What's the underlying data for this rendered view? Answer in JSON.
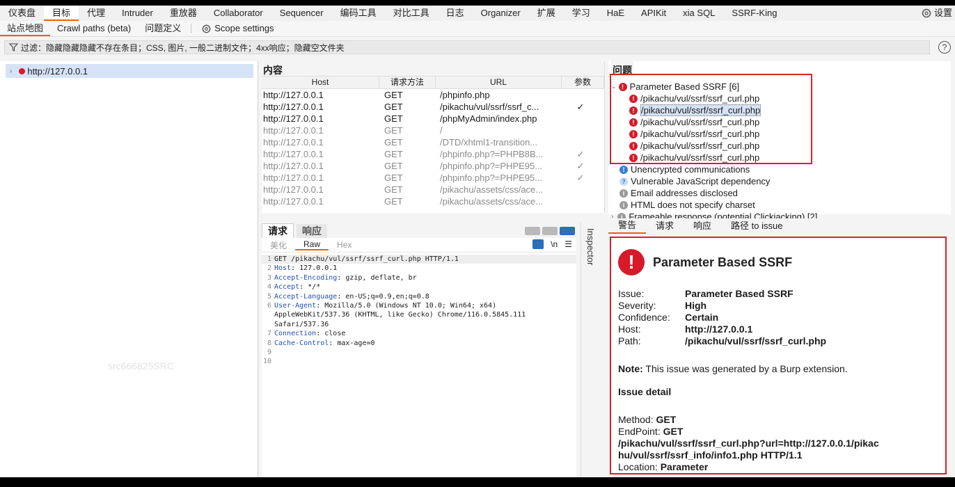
{
  "top_tabs": [
    "仪表盘",
    "目标",
    "代理",
    "Intruder",
    "重放器",
    "Collaborator",
    "Sequencer",
    "编码工具",
    "对比工具",
    "日志",
    "Organizer",
    "扩展",
    "学习",
    "HaE",
    "APIKit",
    "xia SQL",
    "SSRF-King"
  ],
  "settings_label": "设置",
  "sub_tabs": [
    "站点地图",
    "Crawl paths (beta)",
    "问题定义",
    "Scope settings"
  ],
  "filter_text": "过滤：隐藏隐藏隐藏不存在条目；CSS, 图片, 一般二进制文件；4xx响应；隐藏空文件夹",
  "sitemap": {
    "host": "http://127.0.0.1",
    "watermark": "src666825SRC"
  },
  "content": {
    "title": "内容",
    "columns": [
      "Host",
      "请求方法",
      "URL",
      "参数"
    ],
    "rows": [
      {
        "host": "http://127.0.0.1",
        "method": "GET",
        "url": "/phpinfo.php",
        "param": ""
      },
      {
        "host": "http://127.0.0.1",
        "method": "GET",
        "url": "/pikachu/vul/ssrf/ssrf_c...",
        "param": "✓"
      },
      {
        "host": "http://127.0.0.1",
        "method": "GET",
        "url": "/phpMyAdmin/index.php",
        "param": ""
      },
      {
        "host": "http://127.0.0.1",
        "method": "GET",
        "url": "/",
        "param": ""
      },
      {
        "host": "http://127.0.0.1",
        "method": "GET",
        "url": "/DTD/xhtml1-transition...",
        "param": ""
      },
      {
        "host": "http://127.0.0.1",
        "method": "GET",
        "url": "/phpinfo.php?=PHPB8B...",
        "param": "✓"
      },
      {
        "host": "http://127.0.0.1",
        "method": "GET",
        "url": "/phpinfo.php?=PHPE95...",
        "param": "✓"
      },
      {
        "host": "http://127.0.0.1",
        "method": "GET",
        "url": "/phpinfo.php?=PHPE95...",
        "param": "✓"
      },
      {
        "host": "http://127.0.0.1",
        "method": "GET",
        "url": "/pikachu/assets/css/ace...",
        "param": ""
      },
      {
        "host": "http://127.0.0.1",
        "method": "GET",
        "url": "/pikachu/assets/css/ace...",
        "param": ""
      }
    ]
  },
  "request": {
    "tab_request": "请求",
    "tab_response": "响应",
    "view_tabs": [
      "美化",
      "Raw",
      "Hex"
    ],
    "newline_icon": "\\n",
    "lines": [
      {
        "n": "1",
        "k": "",
        "v": "GET /pikachu/vul/ssrf/ssrf_curl.php HTTP/1.1"
      },
      {
        "n": "2",
        "k": "Host",
        "v": ": 127.0.0.1"
      },
      {
        "n": "3",
        "k": "Accept-Encoding",
        "v": ": gzip, deflate, br"
      },
      {
        "n": "4",
        "k": "Accept",
        "v": ": */*"
      },
      {
        "n": "5",
        "k": "Accept-Language",
        "v": ": en-US;q=0.9,en;q=0.8"
      },
      {
        "n": "6",
        "k": "User-Agent",
        "v": ": Mozilla/5.0 (Windows NT 10.0; Win64; x64)"
      },
      {
        "n": "",
        "k": "",
        "v": "AppleWebKit/537.36 (KHTML, like Gecko) Chrome/116.0.5845.111"
      },
      {
        "n": "",
        "k": "",
        "v": "Safari/537.36"
      },
      {
        "n": "7",
        "k": "Connection",
        "v": ": close"
      },
      {
        "n": "8",
        "k": "Cache-Control",
        "v": ": max-age=0"
      },
      {
        "n": "9",
        "k": "",
        "v": ""
      },
      {
        "n": "10",
        "k": "",
        "v": ""
      }
    ]
  },
  "inspector_label": "Inspector",
  "issues": {
    "title": "问题",
    "group": "Parameter Based SSRF [6]",
    "group_items": [
      "/pikachu/vul/ssrf/ssrf_curl.php",
      "/pikachu/vul/ssrf/ssrf_curl.php",
      "/pikachu/vul/ssrf/ssrf_curl.php",
      "/pikachu/vul/ssrf/ssrf_curl.php",
      "/pikachu/vul/ssrf/ssrf_curl.php",
      "/pikachu/vul/ssrf/ssrf_curl.php"
    ],
    "others": [
      "Unencrypted communications",
      "Vulnerable JavaScript dependency",
      "Email addresses disclosed",
      "HTML does not specify charset",
      "Frameable response (potential Clickjacking) [2]"
    ]
  },
  "advisory_tabs": [
    "警告",
    "请求",
    "响应",
    "路径 to issue"
  ],
  "advisory": {
    "title": "Parameter Based SSRF",
    "issue_label": "Issue:",
    "issue": "Parameter Based SSRF",
    "severity_label": "Severity:",
    "severity": "High",
    "confidence_label": "Confidence:",
    "confidence": "Certain",
    "host_label": "Host:",
    "host": "http://127.0.0.1",
    "path_label": "Path:",
    "path": "/pikachu/vul/ssrf/ssrf_curl.php",
    "note_label": "Note:",
    "note": "This issue was generated by a Burp extension.",
    "detail_heading": "Issue detail",
    "method_label": "Method:",
    "method": "GET",
    "endpoint_label": "EndPoint:",
    "endpoint_method": "GET",
    "endpoint_line1": "/pikachu/vul/ssrf/ssrf_curl.php?url=http://127.0.0.1/pikac",
    "endpoint_line2": "hu/vul/ssrf/ssrf_info/info1.php HTTP/1.1",
    "location_label": "Location:",
    "location": "Parameter"
  },
  "colors": {
    "accent": "#e8630a",
    "severity_high": "#d61a2a",
    "highlight_box": "#d92228",
    "selection": "#d5e3f7"
  }
}
